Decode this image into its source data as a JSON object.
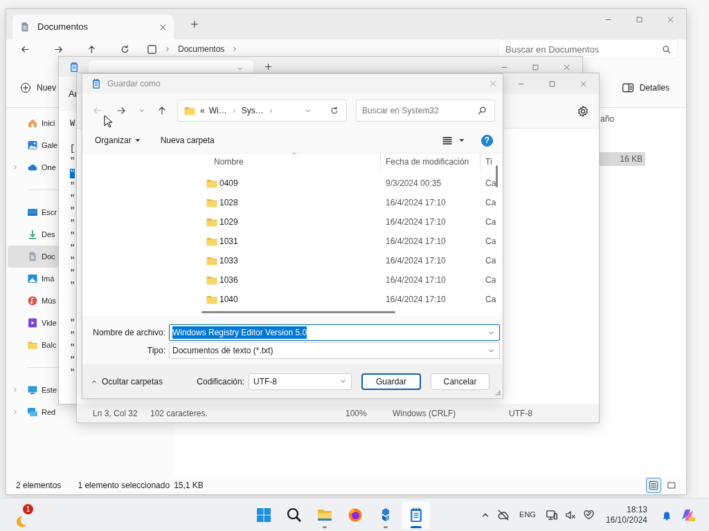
{
  "explorer": {
    "tab_title": "Documentos",
    "path": "Documentos",
    "search_placeholder": "Buscar en Documentos",
    "new_button": "Nuev",
    "details_button": "Detalles",
    "sidebar_groups": [
      {
        "items": [
          {
            "label": "Inici",
            "kind": "home",
            "expandable": false,
            "selected": false
          },
          {
            "label": "Gale",
            "kind": "gallery",
            "expandable": false,
            "selected": false
          },
          {
            "label": "One",
            "kind": "cloud",
            "expandable": true,
            "selected": false
          }
        ]
      },
      {
        "items": [
          {
            "label": "Escr",
            "kind": "desktop",
            "expandable": false,
            "selected": false
          },
          {
            "label": "Des",
            "kind": "download",
            "expandable": false,
            "selected": false
          },
          {
            "label": "Doc",
            "kind": "document",
            "expandable": false,
            "selected": true
          },
          {
            "label": "Imá",
            "kind": "pictures",
            "expandable": false,
            "selected": false
          },
          {
            "label": "Mús",
            "kind": "music",
            "expandable": false,
            "selected": false
          },
          {
            "label": "Vide",
            "kind": "video",
            "expandable": false,
            "selected": false
          },
          {
            "label": "Balc",
            "kind": "folder",
            "expandable": false,
            "selected": false
          }
        ]
      },
      {
        "items": [
          {
            "label": "Este",
            "kind": "pc",
            "expandable": true,
            "selected": false
          },
          {
            "label": "Red",
            "kind": "network",
            "expandable": true,
            "selected": false
          }
        ]
      }
    ],
    "size_column": {
      "header": "año",
      "rows": [
        {
          "size": "16 KB",
          "selected": true
        }
      ]
    },
    "status": {
      "count": "2 elementos",
      "selection": "1 elemento seleccionado",
      "size": "15,1 KB"
    },
    "views": [
      {
        "kind": "details",
        "selected": true
      },
      {
        "kind": "tiles",
        "selected": false
      }
    ]
  },
  "notepad_back": {
    "menu": "Ar",
    "lines": [
      {
        "kind": "text",
        "text": "W",
        "selected": false
      },
      {
        "kind": "blank"
      },
      {
        "kind": "text",
        "text": "[",
        "selected": false
      },
      {
        "kind": "text",
        "text": "\"",
        "selected": false
      },
      {
        "kind": "text",
        "text": "\"",
        "selected": true
      },
      {
        "kind": "text",
        "text": "\"",
        "selected": false
      },
      {
        "kind": "text",
        "text": "\"",
        "selected": false
      },
      {
        "kind": "text",
        "text": "\"",
        "selected": false
      },
      {
        "kind": "text",
        "text": "\"",
        "selected": false
      },
      {
        "kind": "text",
        "text": "\"",
        "selected": false
      },
      {
        "kind": "text",
        "text": "\"",
        "selected": false
      },
      {
        "kind": "text",
        "text": "\"",
        "selected": false
      },
      {
        "kind": "text",
        "text": "\"",
        "selected": false
      },
      {
        "kind": "text",
        "text": "\"",
        "selected": false
      },
      {
        "kind": "blank"
      },
      {
        "kind": "blank"
      },
      {
        "kind": "text",
        "text": "\"",
        "selected": false
      },
      {
        "kind": "text",
        "text": "\"",
        "selected": false
      },
      {
        "kind": "text",
        "text": "\"",
        "selected": false
      },
      {
        "kind": "text",
        "text": "\"",
        "selected": false
      },
      {
        "kind": "text",
        "text": "\"",
        "selected": false
      }
    ]
  },
  "notepad_front": {
    "status": [
      "Ln 3, Col 32",
      "102 caracteres.",
      "100%",
      "Windows (CRLF)",
      "UTF-8"
    ]
  },
  "dialog": {
    "title": "Guardar como",
    "back_disabled": true,
    "address": {
      "overflow": "«",
      "segments": [
        "Wi…",
        "Sys…"
      ]
    },
    "search_placeholder": "Buscar en System32",
    "organize": "Organizar",
    "new_folder": "Nueva carpeta",
    "help": "?",
    "columns": [
      "Nombre",
      "Fecha de modificación",
      "Ti"
    ],
    "rows": [
      {
        "name": "0409",
        "modified": "9/3/2024 00:35",
        "type": "Ca"
      },
      {
        "name": "1028",
        "modified": "16/4/2024 17:10",
        "type": "Ca"
      },
      {
        "name": "1029",
        "modified": "16/4/2024 17:10",
        "type": "Ca"
      },
      {
        "name": "1031",
        "modified": "16/4/2024 17:10",
        "type": "Ca"
      },
      {
        "name": "1033",
        "modified": "16/4/2024 17:10",
        "type": "Ca"
      },
      {
        "name": "1036",
        "modified": "16/4/2024 17:10",
        "type": "Ca"
      },
      {
        "name": "1040",
        "modified": "16/4/2024 17:10",
        "type": "Ca"
      }
    ],
    "file_name": {
      "label": "Nombre de archivo:",
      "value": "Windows Registry Editor Version 5.0",
      "text_selected": true
    },
    "file_type": {
      "label": "Tipo:",
      "value": "Documentos de texto (*.txt)"
    },
    "hide_folders": "Ocultar carpetas",
    "encoding": {
      "label": "Codificación:",
      "value": "UTF-8"
    },
    "buttons": [
      {
        "label": "Guardar",
        "default": true
      },
      {
        "label": "Cancelar",
        "default": false
      }
    ]
  },
  "taskbar": {
    "weather_badge": "1",
    "apps": [
      {
        "kind": "start",
        "running": false,
        "active": false
      },
      {
        "kind": "search",
        "running": false,
        "active": false
      },
      {
        "kind": "explorer",
        "running": true,
        "active": false
      },
      {
        "kind": "firefox",
        "running": false,
        "active": false
      },
      {
        "kind": "app",
        "running": true,
        "active": false
      },
      {
        "kind": "notepad",
        "running": true,
        "active": true
      }
    ],
    "language": "ENG",
    "time": "18:13",
    "date": "16/10/2024"
  }
}
